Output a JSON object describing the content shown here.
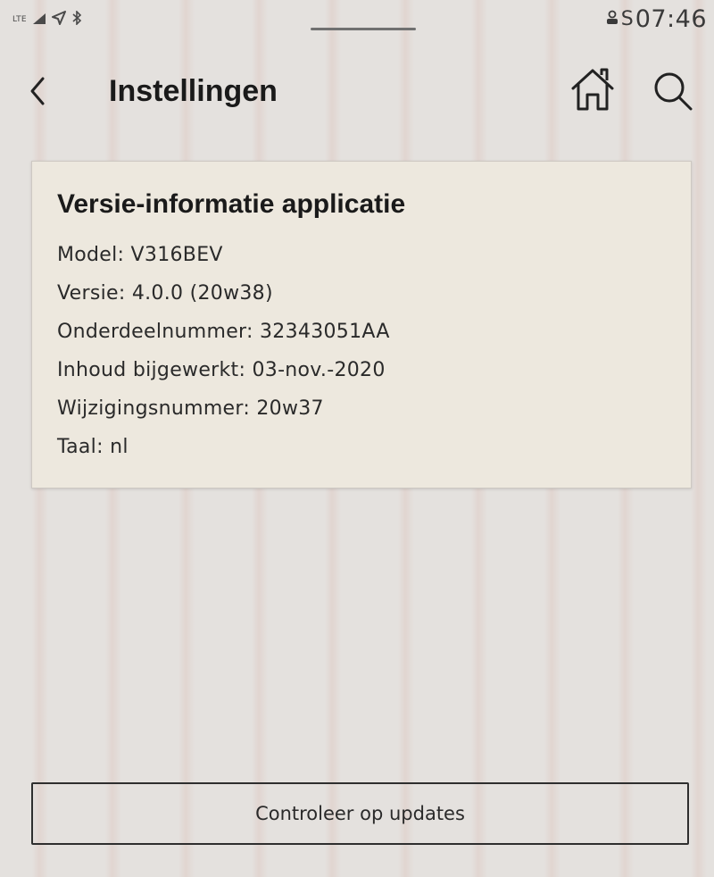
{
  "status_bar": {
    "network": "LTE",
    "icons": [
      "signal-icon",
      "location-icon",
      "bluetooth-icon",
      "user-icon"
    ],
    "sync_indicator": "S",
    "time": "07:46"
  },
  "header": {
    "title": "Instellingen",
    "icons": {
      "back": "back-chevron-icon",
      "home": "home-icon",
      "search": "search-icon"
    }
  },
  "version_card": {
    "title": "Versie-informatie applicatie",
    "rows": [
      "Model: V316BEV",
      "Versie: 4.0.0 (20w38)",
      "Onderdeelnummer: 32343051AA",
      "Inhoud bijgewerkt: 03-nov.-2020",
      "Wijzigingsnummer: 20w37",
      "Taal: nl"
    ]
  },
  "actions": {
    "check_updates_label": "Controleer op updates"
  },
  "colors": {
    "background": "#e4e1de",
    "card_background": "#ede8de",
    "text": "#1a1a1a"
  }
}
